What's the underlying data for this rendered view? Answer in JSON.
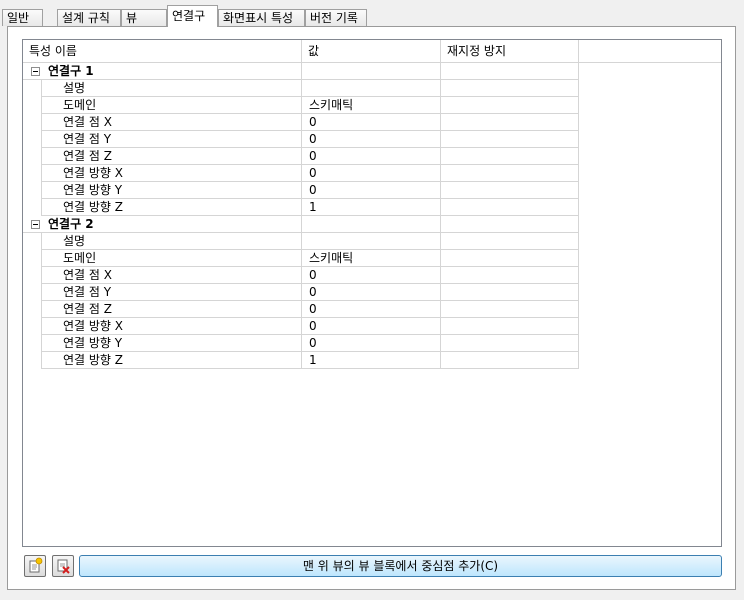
{
  "tabs": [
    {
      "label": "일반"
    },
    {
      "label": "설계 규칙"
    },
    {
      "label": "뷰"
    },
    {
      "label": "연결구"
    },
    {
      "label": "화면표시 특성"
    },
    {
      "label": "버전 기록"
    }
  ],
  "active_tab": "연결구",
  "grid": {
    "columns": [
      "특성 이름",
      "값",
      "재지정 방지"
    ],
    "groups": [
      {
        "name": "연결구 1",
        "expanded": true,
        "rows": [
          {
            "name": "설명",
            "value": ""
          },
          {
            "name": "도메인",
            "value": "스키매틱"
          },
          {
            "name": "연결 점 X",
            "value": "0"
          },
          {
            "name": "연결 점 Y",
            "value": "0"
          },
          {
            "name": "연결 점 Z",
            "value": "0"
          },
          {
            "name": "연결 방향 X",
            "value": "0"
          },
          {
            "name": "연결 방향 Y",
            "value": "0"
          },
          {
            "name": "연결 방향 Z",
            "value": "1"
          }
        ]
      },
      {
        "name": "연결구 2",
        "expanded": true,
        "rows": [
          {
            "name": "설명",
            "value": ""
          },
          {
            "name": "도메인",
            "value": "스키매틱"
          },
          {
            "name": "연결 점 X",
            "value": "0"
          },
          {
            "name": "연결 점 Y",
            "value": "0"
          },
          {
            "name": "연결 점 Z",
            "value": "0"
          },
          {
            "name": "연결 방향 X",
            "value": "0"
          },
          {
            "name": "연결 방향 Y",
            "value": "0"
          },
          {
            "name": "연결 방향 Z",
            "value": "1"
          }
        ]
      }
    ]
  },
  "buttons": {
    "add_icon": "add-connector-icon",
    "remove_icon": "remove-connector-icon",
    "main_label": "맨 위 뷰의 뷰 블록에서 중심점 추가(C)"
  }
}
